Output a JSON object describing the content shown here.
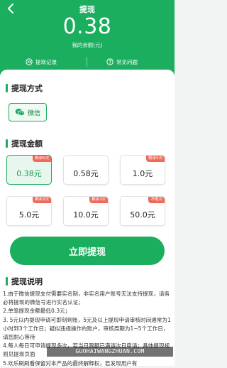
{
  "header": {
    "title": "提现",
    "amount": "0.38",
    "balance_label": "我的余额(元)",
    "links": [
      "提现记录",
      "常见问题"
    ]
  },
  "method": {
    "section_title": "提现方式",
    "option": "微信"
  },
  "amounts": {
    "section_title": "提现金额",
    "options": [
      {
        "value": "0.38元",
        "badge": "剩余5次",
        "selected": true
      },
      {
        "value": "0.58元",
        "badge": ""
      },
      {
        "value": "1.0元",
        "badge": "剩余5次"
      },
      {
        "value": "5.0元",
        "badge": "剩余3次"
      },
      {
        "value": "10.0元",
        "badge": "剩余3次"
      },
      {
        "value": "50.0元",
        "badge": "不限次"
      }
    ]
  },
  "submit_label": "立即提现",
  "instructions": {
    "section_title": "提现说明",
    "lines": [
      "1.由于微信提现支付需要实名制，非实名用户账号无法支持提现，请务必将提现的微信号进行实名认证；",
      "2.单笔提现金额最低0.3元；",
      "3. 5元以内提现申请可即刻到账，5元及以上提现申请审核时间通常为1小时到3个工作日；疑似违规操作的账户，审核周期为1~5个工作日，请您耐心等待",
      "4.每人每日可申请提现多次，若当日限额已满请次日申请；具体提现规则见提现页面",
      "5.欢乐刷刷看保留对本产品的最终解释权，若发现用户有"
    ]
  },
  "watermark": "GUOHAIWANGZHUAN.COM",
  "colors": {
    "accent": "#1aae5e",
    "badge": "#f06a5a"
  }
}
